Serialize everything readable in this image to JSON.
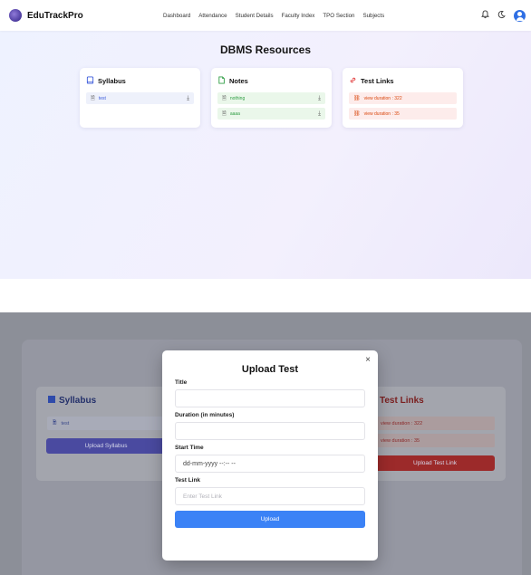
{
  "navbar": {
    "brand": "EduTrackPro",
    "links": [
      "Dashboard",
      "Attendance",
      "Student Details",
      "Faculty Index",
      "TPO Section",
      "Subjects"
    ],
    "icons": [
      "bell-icon",
      "moon-icon",
      "user-icon"
    ]
  },
  "page": {
    "title": "DBMS Resources"
  },
  "syllabus": {
    "title": "Syllabus",
    "items": [
      {
        "name": "test"
      }
    ]
  },
  "notes": {
    "title": "Notes",
    "items": [
      {
        "name": "nothing"
      },
      {
        "name": "aaaa"
      }
    ]
  },
  "test_links": {
    "title": "Test Links",
    "items": [
      {
        "text": "view  duration : 322"
      },
      {
        "text": "view  duration : 35"
      }
    ]
  },
  "background": {
    "syllabus_title": "Syllabus",
    "syllabus_item": "test",
    "upload_syllabus": "Upload Syllabus",
    "tests_title": "Test Links",
    "test_row_1": "view  duration : 322",
    "test_row_2": "view  duration : 35",
    "upload_test_link": "Upload Test Link"
  },
  "modal": {
    "close": "×",
    "title": "Upload Test",
    "fields": {
      "title_label": "Title",
      "title_value": "",
      "duration_label": "Duration (in minutes)",
      "duration_value": "",
      "start_label": "Start Time",
      "start_value": "dd-mm-yyyy --:-- --",
      "link_label": "Test Link",
      "link_placeholder": "Enter Test Link"
    },
    "submit": "Upload"
  },
  "colors": {
    "accent_blue": "#3b82f6",
    "syllabus_indigo": "#3b5bdb",
    "notes_green": "#2f9e44",
    "links_red": "#d9480f"
  }
}
